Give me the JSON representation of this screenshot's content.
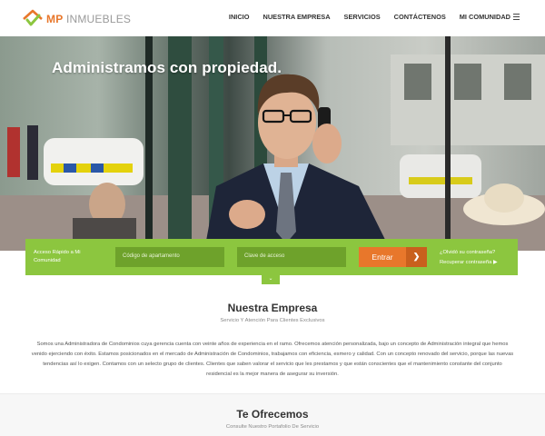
{
  "brand": {
    "prefix": "MP",
    "suffix": "INMUEBLES",
    "logo_colors": [
      "#e8772b",
      "#8cc63f"
    ]
  },
  "nav": {
    "items": [
      {
        "label": "INICIO"
      },
      {
        "label": "NUESTRA EMPRESA"
      },
      {
        "label": "SERVICIOS"
      },
      {
        "label": "CONTÁCTENOS"
      },
      {
        "label": "MI COMUNIDAD"
      }
    ],
    "menu_icon": "menu-list-icon"
  },
  "hero": {
    "headline": "Administramos con propiedad."
  },
  "login": {
    "quick_access": "Acceso Rápido a Mi Comunidad",
    "apartment_placeholder": "Código de apartamento",
    "password_placeholder": "Clave de acceso",
    "submit_label": "Entrar",
    "submit_icon": "chevron-right-icon",
    "forgot_password": "¿Olvidó su contraseña?",
    "recover_password": "Recuperar contraseña ▶",
    "expand_icon": "chevron-down-icon",
    "colors": {
      "bar": "#8cc63f",
      "input": "#6ea22b",
      "button": "#e8772b"
    }
  },
  "empresa": {
    "title": "Nuestra Empresa",
    "subtitle": "Servicio Y Atención Para Clientes Exclusivos",
    "paragraph": "Somos una Administradora de Condominios cuya gerencia cuenta con veinte años de experiencia en el ramo. Ofrecemos atención personalizada, bajo un concepto de Administración integral que hemos venido ejerciendo con éxito. Estamos posicionados en el mercado de Administración de Condominios, trabajamos con eficiencia, esmero y calidad. Con un concepto renovado del servicio, porque las nuevas tendencias así lo exigen. Contamos con un selecto grupo de clientes. Clientes que saben valorar el servicio que les prestamos y que están conscientes que el mantenimiento constante del conjunto residencial es la mejor manera de asegurar su inversión."
  },
  "ofrecemos": {
    "title": "Te Ofrecemos",
    "subtitle": "Consulte Nuestro Portafolio De Servicio"
  }
}
